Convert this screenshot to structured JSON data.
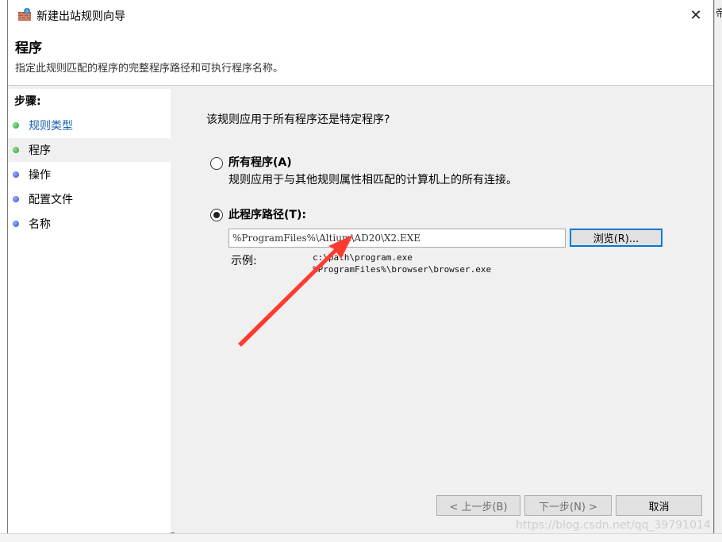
{
  "window": {
    "title": "新建出站规则向导",
    "close_glyph": "✕"
  },
  "header": {
    "title": "程序",
    "description": "指定此规则匹配的程序的完整程序路径和可执行程序名称。"
  },
  "steps": {
    "heading": "步骤:",
    "items": [
      {
        "label": "规则类型",
        "state": "done",
        "dot_color": "#2e9d2e"
      },
      {
        "label": "程序",
        "state": "active",
        "dot_color": "#2e9d2e"
      },
      {
        "label": "操作",
        "state": "pending",
        "dot_color": "#3b4fd0"
      },
      {
        "label": "配置文件",
        "state": "pending",
        "dot_color": "#3b4fd0"
      },
      {
        "label": "名称",
        "state": "pending",
        "dot_color": "#3b4fd0"
      }
    ]
  },
  "main": {
    "question": "该规则应用于所有程序还是特定程序?",
    "option_all": {
      "label": "所有程序(A)",
      "description": "规则应用于与其他规则属性相匹配的计算机上的所有连接。",
      "checked": false
    },
    "option_path": {
      "label": "此程序路径(T):",
      "checked": true
    },
    "path_value": "%ProgramFiles%\\Altium\\AD20\\X2.EXE",
    "browse_label": "浏览(R)...",
    "example_label": "示例:",
    "example_line1": "c:\\path\\program.exe",
    "example_line2": "%ProgramFiles%\\browser\\browser.exe"
  },
  "buttons": {
    "back_label": "< 上一步(B)",
    "next_label": "下一步(N) >",
    "cancel_label": "取消"
  },
  "background": {
    "right_fragment": "帝"
  },
  "watermark": "https://blog.csdn.net/qq_39791014",
  "colors": {
    "accent": "#0078d7",
    "link": "#1a5fb4",
    "annotation_arrow": "#ff3b30"
  }
}
